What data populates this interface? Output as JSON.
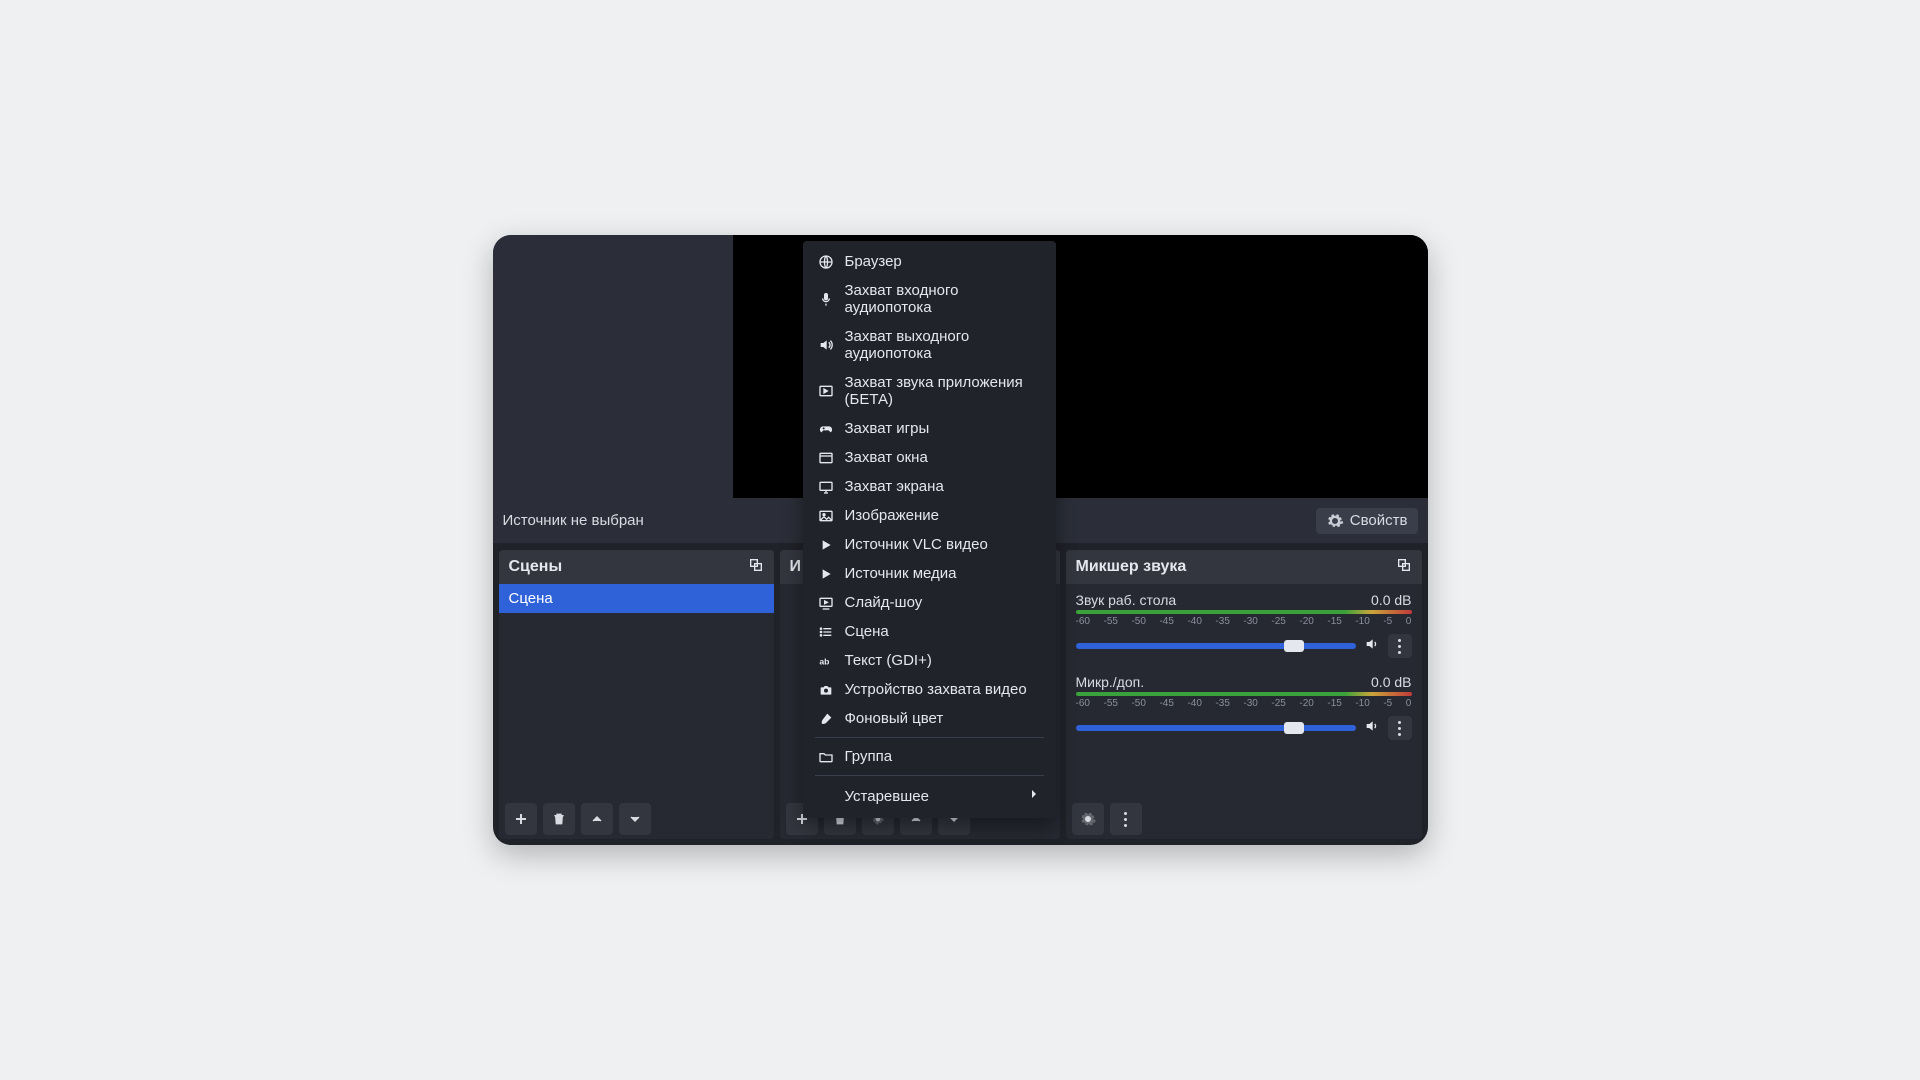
{
  "toolbar": {
    "status": "Источник не выбран",
    "properties_label": "Свойств"
  },
  "panels": {
    "scenes": {
      "title": "Сцены",
      "items": [
        "Сцена"
      ]
    },
    "sources": {
      "title_partial": "И"
    },
    "mixer": {
      "title": "Микшер звука"
    }
  },
  "context_menu": {
    "items": [
      {
        "icon": "globe",
        "label": "Браузер"
      },
      {
        "icon": "mic",
        "label": "Захват входного аудиопотока"
      },
      {
        "icon": "speaker",
        "label": "Захват выходного аудиопотока"
      },
      {
        "icon": "app-audio",
        "label": "Захват звука приложения (БЕТА)"
      },
      {
        "icon": "gamepad",
        "label": "Захват игры"
      },
      {
        "icon": "window",
        "label": "Захват окна"
      },
      {
        "icon": "display",
        "label": "Захват экрана"
      },
      {
        "icon": "image",
        "label": "Изображение"
      },
      {
        "icon": "play",
        "label": "Источник VLC видео"
      },
      {
        "icon": "play",
        "label": "Источник медиа"
      },
      {
        "icon": "slideshow",
        "label": "Слайд-шоу"
      },
      {
        "icon": "list",
        "label": "Сцена"
      },
      {
        "icon": "text",
        "label": "Текст (GDI+)"
      },
      {
        "icon": "camera",
        "label": "Устройство захвата видео"
      },
      {
        "icon": "brush",
        "label": "Фоновый цвет"
      }
    ],
    "group_label": "Группа",
    "deprecated_label": "Устаревшее"
  },
  "mixer": {
    "ticks": [
      "-60",
      "-55",
      "-50",
      "-45",
      "-40",
      "-35",
      "-30",
      "-25",
      "-20",
      "-15",
      "-10",
      "-5",
      "0"
    ],
    "channels": [
      {
        "name": "Звук раб. стола",
        "level": "0.0 dB",
        "slider_pct": 78
      },
      {
        "name": "Микр./доп.",
        "level": "0.0 dB",
        "slider_pct": 78
      }
    ]
  }
}
